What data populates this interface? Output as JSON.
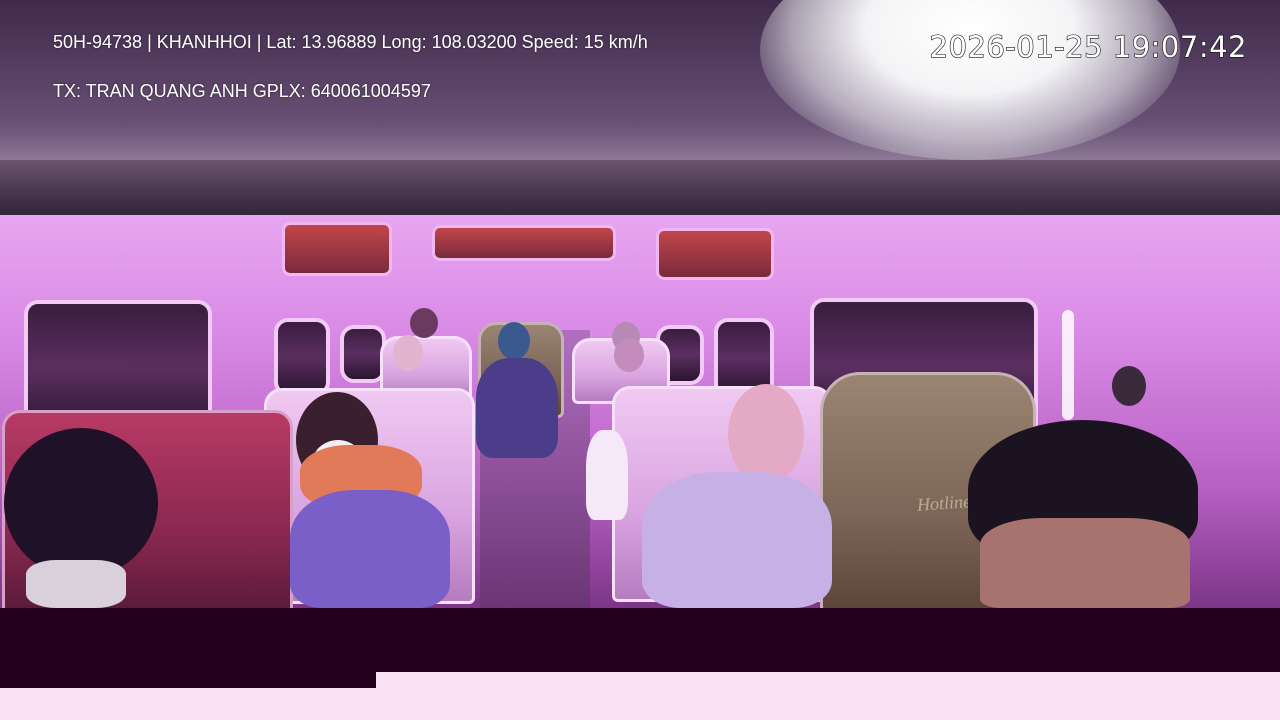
{
  "overlay": {
    "line1": "50H-94738 | KHANHHOI | Lat: 13.96889 Long: 108.03200 Speed: 15 km/h",
    "line2": "TX: TRAN QUANG ANH GPLX: 640061004597",
    "timestamp": "2026-01-25 19:07:42"
  },
  "scene": {
    "headrest_logo_text": "Hotline"
  },
  "colors": {
    "cabin_light": "#d98ae6",
    "dark_bar": "#23001c",
    "bottom_light": "#fbe3f7"
  }
}
